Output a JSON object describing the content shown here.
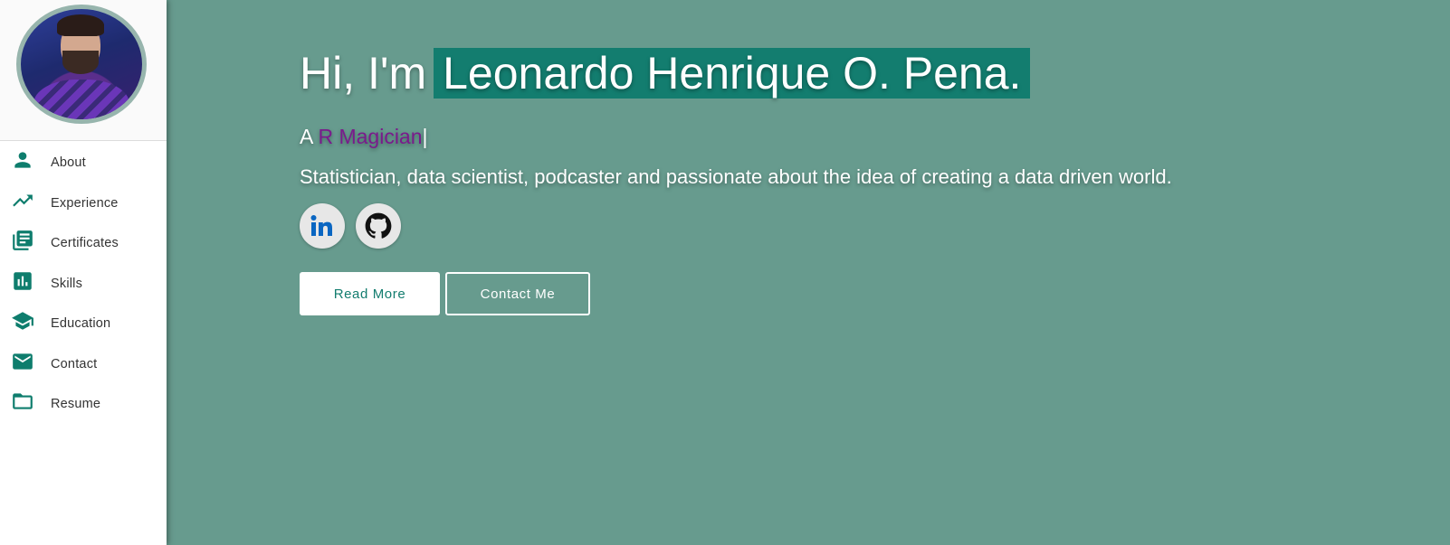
{
  "theme": {
    "accent": "#137d6f",
    "background": "#679b8e",
    "role_color": "#7a1b8c"
  },
  "sidebar": {
    "avatar_alt": "profile photo",
    "items": [
      {
        "label": "About",
        "icon": "person-icon"
      },
      {
        "label": "Experience",
        "icon": "trending-up-icon"
      },
      {
        "label": "Certificates",
        "icon": "library-books-icon"
      },
      {
        "label": "Skills",
        "icon": "bar-chart-icon"
      },
      {
        "label": "Education",
        "icon": "school-icon"
      },
      {
        "label": "Contact",
        "icon": "mail-icon"
      },
      {
        "label": "Resume",
        "icon": "folder-icon"
      }
    ]
  },
  "hero": {
    "greeting": "Hi, I'm",
    "name": "Leonardo Henrique O. Pena.",
    "tagline_prefix": "A",
    "role": "R Magician",
    "cursor": "|",
    "description": "Statistician, data scientist, podcaster and passionate about the idea of creating a data driven world."
  },
  "socials": [
    {
      "name": "linkedin",
      "icon": "linkedin-icon"
    },
    {
      "name": "github",
      "icon": "github-icon"
    }
  ],
  "buttons": {
    "read_more": "Read More",
    "contact_me": "Contact Me"
  }
}
